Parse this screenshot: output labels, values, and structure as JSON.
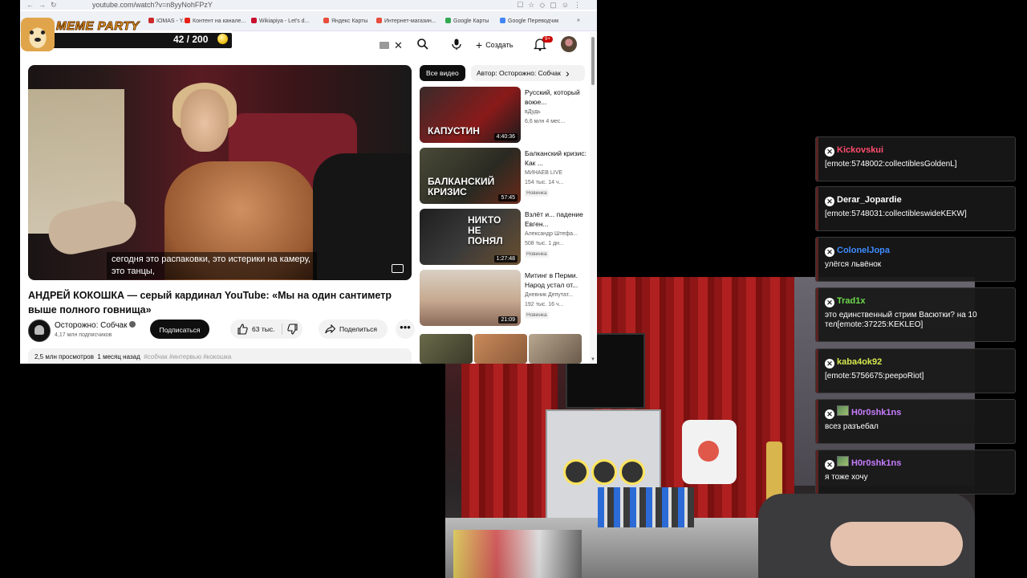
{
  "browser": {
    "url": "youtube.com/watch?v=n8yyNohFPzY",
    "bookmarks": [
      {
        "label": "IOMAS - Y...",
        "color": "#cc2a2a"
      },
      {
        "label": "Контент на канале...",
        "color": "#e62117"
      },
      {
        "label": "Wikiapiya - Let's d...",
        "color": "#c8102e"
      },
      {
        "label": "Яндекс Карты",
        "color": "#e84d3d"
      },
      {
        "label": "Интернет-магазин...",
        "color": "#e84d3d"
      },
      {
        "label": "Google Карты",
        "color": "#34a853"
      },
      {
        "label": "Google Переводчик",
        "color": "#4285f4"
      }
    ],
    "more_bookmarks": "»"
  },
  "youtube": {
    "create_label": "Создать",
    "notification_count": "9+",
    "video": {
      "subtitle": "сегодня это распаковки, это истерики на камеру, это танцы,",
      "title": "АНДРЕЙ КОКОШКА — серый кардинал YouTube: «Мы на один сантиметр выше полного говнища»",
      "channel": "Осторожно: Собчак",
      "subscribers": "4,17 млн подписчиков",
      "subscribe_label": "Подписаться",
      "likes": "63 тыс.",
      "share_label": "Поделиться",
      "more_label": "•••",
      "views": "2,5 млн просмотров",
      "date": "1 месяц назад",
      "tags": "#собчак #интервью #кокошка"
    },
    "chips": {
      "all": "Все видео",
      "author": "Автор: Осторожно: Собчак",
      "next": "›"
    },
    "recommendations": [
      {
        "title": "Русский, который воюе...",
        "channel": "вДудь",
        "meta": "6,6 млн  4 мес...",
        "duration": "4:40:36",
        "thumb_text": "КАПУСТИН",
        "thumb_color": "#8a1a1a",
        "badge": ""
      },
      {
        "title": "Балканский кризис: Как ...",
        "channel": "МИНАЕВ LIVE",
        "meta": "154 тыс.  14 ч...",
        "duration": "57:45",
        "thumb_text": "БАЛКАНСКИЙ КРИЗИС",
        "thumb_color": "#3a3a2a",
        "badge": "Новинка"
      },
      {
        "title": "Взлёт и... падение Евген...",
        "channel": "Александр Штефа...",
        "meta": "508 тыс.  1 дн...",
        "duration": "1:27:48",
        "thumb_text": "НИКТО НЕ ПОНЯЛ",
        "thumb_color": "#2a2a2a",
        "badge": "Новинка"
      },
      {
        "title": "Митинг в Перми. Народ устал от...",
        "channel": "Дневник Депутат...",
        "meta": "192 тыс.  16 ч...",
        "duration": "21:09",
        "thumb_text": "",
        "thumb_color": "#c9b8a6",
        "badge": "Новинка"
      }
    ]
  },
  "meme_party": {
    "title": "MEME PARTY",
    "progress_text": "42 / 200",
    "progress_value": 42,
    "progress_max": 200
  },
  "chat": {
    "messages": [
      {
        "user": "Kickovskui",
        "color": "#ff4d6d",
        "text": "[emote:5748002:collectiblesGoldenL]",
        "avatar": false
      },
      {
        "user": "Derar_Jopardie",
        "color": "#ffffff",
        "text": "[emote:5748031:collectibleswideKEKW]",
        "avatar": false
      },
      {
        "user": "ColonelJopa",
        "color": "#3d8bff",
        "text": "улёгся львёнок",
        "avatar": false
      },
      {
        "user": "Trad1x",
        "color": "#6ddb4a",
        "text": "это единственный стрим Васютки? на 10 тел[emote:37225:KEKLEO]",
        "avatar": false
      },
      {
        "user": "kaba4ok92",
        "color": "#d6e84d",
        "text": "[emote:5756675:peepoRiot]",
        "avatar": false
      },
      {
        "user": "H0r0shk1ns",
        "color": "#c77dff",
        "text": "всез разъебал",
        "avatar": true
      },
      {
        "user": "H0r0shk1ns",
        "color": "#c77dff",
        "text": "я тоже хочу",
        "avatar": true
      }
    ]
  }
}
